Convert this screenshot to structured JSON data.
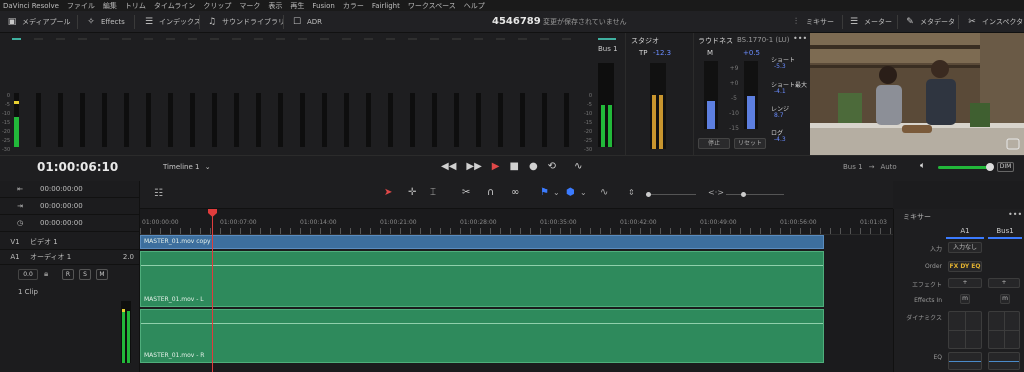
{
  "menu": [
    "DaVinci Resolve",
    "ファイル",
    "編集",
    "トリム",
    "タイムライン",
    "クリップ",
    "マーク",
    "表示",
    "再生",
    "Fusion",
    "カラー",
    "Fairlight",
    "ワークスペース",
    "ヘルプ"
  ],
  "toolbar": {
    "media_pool": "メディアプール",
    "effects": "Effects",
    "index": "インデックス",
    "sound_library": "サウンドライブラリ",
    "adr": "ADR",
    "mixer": "ミキサー",
    "meter": "メーター",
    "metadata": "メタデータ",
    "inspector": "インスペクタ"
  },
  "project": {
    "title": "4546789",
    "status": "変更が保存されていません"
  },
  "meters": {
    "scale": [
      "0",
      "-5",
      "-10",
      "-15",
      "-20",
      "-25",
      "-30",
      "-40",
      "-50"
    ],
    "ch1_level": 0.55,
    "ch1_peak_color": "#e8d030",
    "bus_label": "Bus 1",
    "bus_level": 0.5
  },
  "studio": {
    "title": "スタジオ",
    "tp_label": "TP",
    "tp_value": "-12.3"
  },
  "loudness": {
    "title": "ラウドネス",
    "standard": "BS.1770-1 (LU)",
    "m_label": "M",
    "m_value": "+0.5",
    "short_label": "ショート",
    "short_value": "-5.3",
    "short_max_label": "ショート最大",
    "short_max_value": "-4.1",
    "range_label": "レンジ",
    "range_value": "8.7",
    "integrated_label": "ログ",
    "integrated_value": "-4.3",
    "pause": "停止",
    "reset": "リセット",
    "scale": [
      "+9",
      "+0",
      "-5",
      "-10",
      "-15"
    ]
  },
  "transport": {
    "timecode": "01:00:06:10",
    "timeline_name": "Timeline 1",
    "bus_out": "Bus 1",
    "auto": "Auto",
    "dim": "DIM"
  },
  "left": {
    "tc1": "00:00:00:00",
    "tc2": "00:00:00:00",
    "tc3": "00:00:00:00",
    "v1": "V1",
    "v1_name": "ビデオ 1",
    "a1": "A1",
    "a1_name": "オーディオ 1",
    "a1_ch": "2.0",
    "vol": "0.0",
    "r": "R",
    "s": "S",
    "m": "M",
    "clips": "1 Clip"
  },
  "ruler": [
    "01:00:00:00",
    "01:00:07:00",
    "01:00:14:00",
    "01:00:21:00",
    "01:00:28:00",
    "01:00:35:00",
    "01:00:42:00",
    "01:00:49:00",
    "01:00:56:00",
    "01:01:03"
  ],
  "clips": {
    "video": "MASTER_01.mov copy",
    "audio_l": "MASTER_01.mov - L",
    "audio_r": "MASTER_01.mov - R"
  },
  "mixer": {
    "title": "ミキサー",
    "col1": "A1",
    "col2": "Bus1",
    "input_label": "入力",
    "input_value": "入力なし",
    "order_label": "Order",
    "order_value": "FX DY EQ",
    "effects_label": "エフェクト",
    "effects_in_label": "Effects In",
    "dynamics_label": "ダイナミクス",
    "eq_label": "EQ",
    "plus": "+",
    "m": "m"
  }
}
